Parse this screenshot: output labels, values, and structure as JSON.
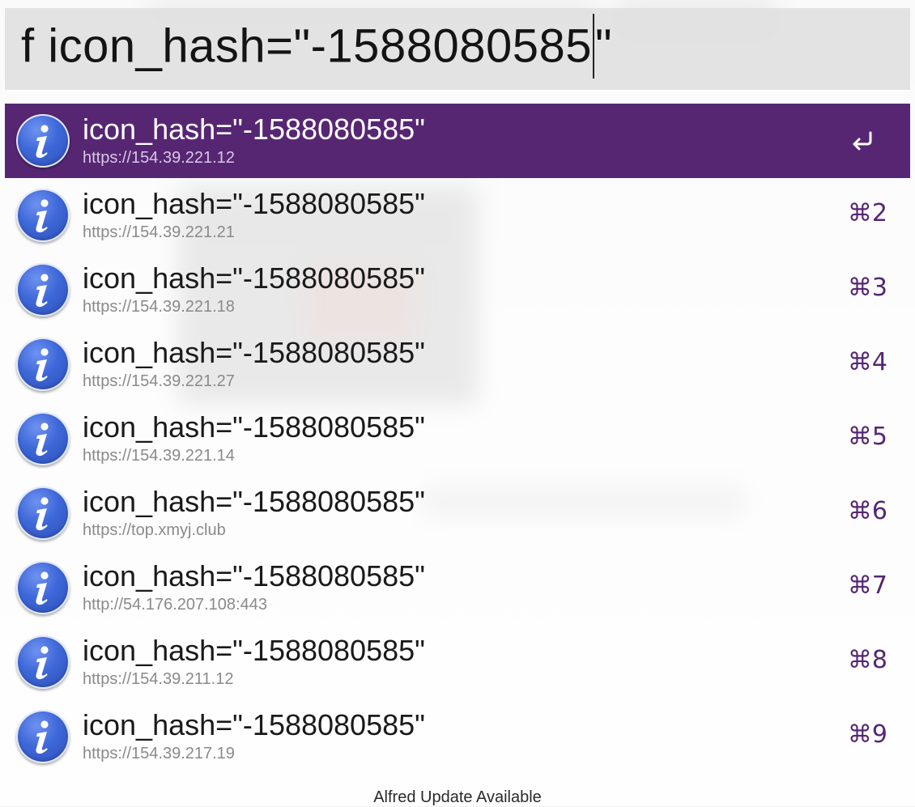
{
  "search": {
    "query_before_caret": "f icon_hash=\"-1588080585",
    "query_after_caret": "\""
  },
  "results": [
    {
      "title": "icon_hash=\"-1588080585\"",
      "subtitle": "https://154.39.221.12",
      "shortcut": "↩",
      "selected": true
    },
    {
      "title": "icon_hash=\"-1588080585\"",
      "subtitle": "https://154.39.221.21",
      "shortcut": "⌘2",
      "selected": false
    },
    {
      "title": "icon_hash=\"-1588080585\"",
      "subtitle": "https://154.39.221.18",
      "shortcut": "⌘3",
      "selected": false
    },
    {
      "title": "icon_hash=\"-1588080585\"",
      "subtitle": "https://154.39.221.27",
      "shortcut": "⌘4",
      "selected": false
    },
    {
      "title": "icon_hash=\"-1588080585\"",
      "subtitle": "https://154.39.221.14",
      "shortcut": "⌘5",
      "selected": false
    },
    {
      "title": "icon_hash=\"-1588080585\"",
      "subtitle": "https://top.xmyj.club",
      "shortcut": "⌘6",
      "selected": false
    },
    {
      "title": "icon_hash=\"-1588080585\"",
      "subtitle": "http://54.176.207.108:443",
      "shortcut": "⌘7",
      "selected": false
    },
    {
      "title": "icon_hash=\"-1588080585\"",
      "subtitle": "https://154.39.211.12",
      "shortcut": "⌘8",
      "selected": false
    },
    {
      "title": "icon_hash=\"-1588080585\"",
      "subtitle": "https://154.39.217.19",
      "shortcut": "⌘9",
      "selected": false
    }
  ],
  "icons": {
    "result_icon": "info-icon",
    "return_icon": "return-icon"
  },
  "colors": {
    "selected_background": "#562673",
    "shortcut_text": "#562673",
    "icon_blue": "#3e68d9"
  },
  "footer": {
    "text": "Alfred Update Available"
  }
}
